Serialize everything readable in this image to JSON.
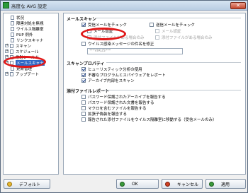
{
  "window": {
    "title": "高度な AVG 設定",
    "close_glyph": "✕"
  },
  "tree": {
    "items": [
      {
        "label": "状況",
        "toggle": ""
      },
      {
        "label": "障害対処を無視",
        "toggle": ""
      },
      {
        "label": "ウイルス隔離室",
        "toggle": ""
      },
      {
        "label": "PUP 例外",
        "toggle": ""
      },
      {
        "label": "リンクスキャナ",
        "toggle": ""
      },
      {
        "label": "スキャン",
        "toggle": "+"
      },
      {
        "label": "スケジュール",
        "toggle": "+"
      },
      {
        "label": "常駐シールド",
        "toggle": "+"
      },
      {
        "label": "メールスキャナ",
        "toggle": "+"
      },
      {
        "label": "更新管理",
        "toggle": ""
      },
      {
        "label": "アップデート",
        "toggle": "+"
      }
    ]
  },
  "panel": {
    "mail_scan": {
      "title": "メールスキャン",
      "check_incoming": "受信メールをチェック",
      "check_outgoing": "送信メールをチェック",
      "certify_incoming": "メール認証",
      "certify_outgoing": "メール認証",
      "attach_incoming": "添付ファイルがある場合のみ",
      "attach_outgoing": "添付ファイルがある場合のみ",
      "modify_subject": "ウイルス感染メッセージの件名を修正",
      "subject_value": "***VIRUS***"
    },
    "scan_props": {
      "title": "スキャンプロパティ",
      "heuristics": "ヒューリスティック分析の使用",
      "pup": "不審なプログラムとスパイウェアをレポート",
      "archives": "アーカイブ内部をスキャン"
    },
    "attach_report": {
      "title": "添付ファイルレポート",
      "pw_archive": "パスワード保護されたアーカイブを報告する",
      "pw_docs": "パスワード保護された文書を報告する",
      "macro": "マクロを含むファイルを報告する",
      "hidden_ext": "拡張子偽装を報告する",
      "move_quarantine": "報告された添付ファイルをウイルス隔離室に移動する（受信メールのみ）"
    }
  },
  "buttons": {
    "default": "デフォルト",
    "ok": "OK",
    "cancel": "キャンセル",
    "apply": "適用"
  },
  "colors": {
    "selection": "#3169c6",
    "highlight_ellipse": "#e01818"
  }
}
